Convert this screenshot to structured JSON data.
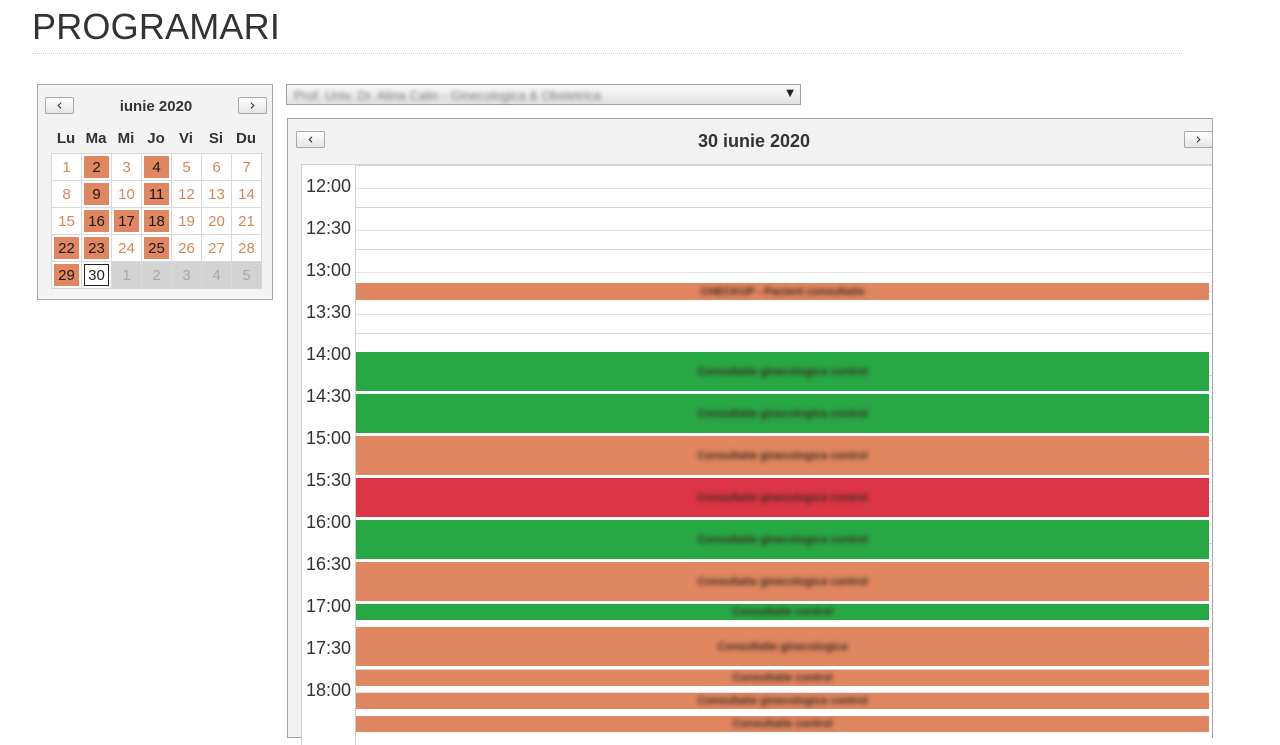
{
  "page": {
    "title": "PROGRAMARI"
  },
  "mini_calendar": {
    "month_label": "iunie 2020",
    "prev_icon": "‹",
    "next_icon": "›",
    "weekdays": [
      "Lu",
      "Ma",
      "Mi",
      "Jo",
      "Vi",
      "Si",
      "Du"
    ],
    "days": [
      {
        "d": "1",
        "state": "normal"
      },
      {
        "d": "2",
        "state": "busy"
      },
      {
        "d": "3",
        "state": "normal"
      },
      {
        "d": "4",
        "state": "busy"
      },
      {
        "d": "5",
        "state": "normal"
      },
      {
        "d": "6",
        "state": "normal"
      },
      {
        "d": "7",
        "state": "normal"
      },
      {
        "d": "8",
        "state": "normal"
      },
      {
        "d": "9",
        "state": "busy"
      },
      {
        "d": "10",
        "state": "normal"
      },
      {
        "d": "11",
        "state": "busy"
      },
      {
        "d": "12",
        "state": "normal"
      },
      {
        "d": "13",
        "state": "normal"
      },
      {
        "d": "14",
        "state": "normal"
      },
      {
        "d": "15",
        "state": "normal"
      },
      {
        "d": "16",
        "state": "busy"
      },
      {
        "d": "17",
        "state": "busy"
      },
      {
        "d": "18",
        "state": "busy"
      },
      {
        "d": "19",
        "state": "normal"
      },
      {
        "d": "20",
        "state": "normal"
      },
      {
        "d": "21",
        "state": "normal"
      },
      {
        "d": "22",
        "state": "busy"
      },
      {
        "d": "23",
        "state": "busy"
      },
      {
        "d": "24",
        "state": "normal"
      },
      {
        "d": "25",
        "state": "busy"
      },
      {
        "d": "26",
        "state": "normal"
      },
      {
        "d": "27",
        "state": "normal"
      },
      {
        "d": "28",
        "state": "normal"
      },
      {
        "d": "29",
        "state": "busy"
      },
      {
        "d": "30",
        "state": "today"
      },
      {
        "d": "1",
        "state": "other"
      },
      {
        "d": "2",
        "state": "other"
      },
      {
        "d": "3",
        "state": "other"
      },
      {
        "d": "4",
        "state": "other"
      },
      {
        "d": "5",
        "state": "other"
      }
    ]
  },
  "doctor_select": {
    "selected": "Prof. Univ. Dr. Alina Calin - Ginecologica & Obstetrica",
    "arrow_icon": "▼"
  },
  "day_view": {
    "title": "30 iunie 2020",
    "prev_icon": "‹",
    "next_icon": "›",
    "time_labels": [
      "12:00",
      "12:30",
      "13:00",
      "13:30",
      "14:00",
      "14:30",
      "15:00",
      "15:30",
      "16:00",
      "16:30",
      "17:00",
      "17:30",
      "18:00"
    ],
    "appointments": [
      {
        "time": "13:00",
        "color": "orange",
        "label": "CHECKUP - Pacient consultatie"
      },
      {
        "time": "14:00",
        "color": "green",
        "label": "Consultatie ginecologica control"
      },
      {
        "time": "14:30",
        "color": "green",
        "label": "Consultatie ginecologica control"
      },
      {
        "time": "15:00",
        "color": "orange",
        "label": "Consultatie ginecologica control"
      },
      {
        "time": "15:30",
        "color": "red",
        "label": "Consultatie ginecologica control"
      },
      {
        "time": "16:00",
        "color": "green",
        "label": "Consultatie ginecologica control"
      },
      {
        "time": "16:30",
        "color": "orange",
        "label": "Consultatie ginecologica control"
      },
      {
        "time": "16:50",
        "color": "green",
        "label": "Consultatie control"
      },
      {
        "time": "17:00",
        "color": "orange",
        "label": "Consultatie ginecologica"
      },
      {
        "time": "17:30",
        "color": "orange",
        "label": "Consultatie control"
      },
      {
        "time": "17:45",
        "color": "orange",
        "label": "Consultatie ginecologica control"
      },
      {
        "time": "18:00",
        "color": "orange",
        "label": "Consultatie control"
      }
    ]
  },
  "colors": {
    "busy": "#e08660",
    "green": "#28a745",
    "red": "#dc3545",
    "orange": "#e08660"
  }
}
